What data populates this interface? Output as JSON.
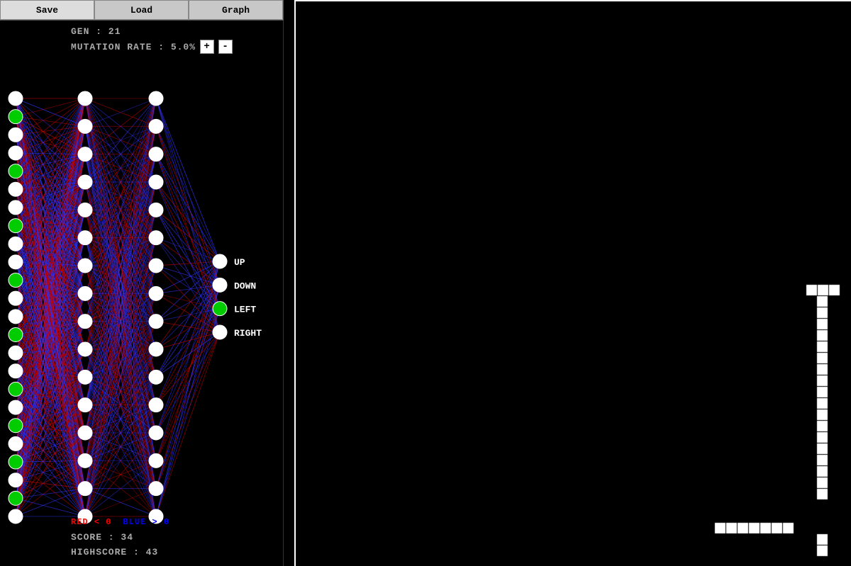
{
  "toolbar": {
    "save_label": "Save",
    "load_label": "Load",
    "graph_label": "Graph"
  },
  "info": {
    "gen_label": "GEN : 21",
    "mutation_label": "MUTATION RATE : 5.0%",
    "plus_label": "+",
    "minus_label": "-"
  },
  "legend": {
    "red_label": "RED < 0",
    "blue_label": "BLUE > 0"
  },
  "score": {
    "score_label": "SCORE : 34",
    "highscore_label": "HIGHSCORE : 43"
  },
  "outputs": {
    "up": "UP",
    "down": "DOWN",
    "left": "LEFT",
    "right": "RIGHT"
  },
  "colors": {
    "green_node": "#00cc00",
    "white_node": "#ffffff",
    "red_conn": "#cc0000",
    "blue_conn": "#3333ff",
    "active_output": "#00cc00"
  },
  "nn": {
    "input_count": 24,
    "hidden_count": 16,
    "output_count": 4,
    "active_inputs": [
      1,
      4,
      7,
      10,
      13,
      16,
      18,
      20,
      22
    ],
    "active_output": 2
  }
}
